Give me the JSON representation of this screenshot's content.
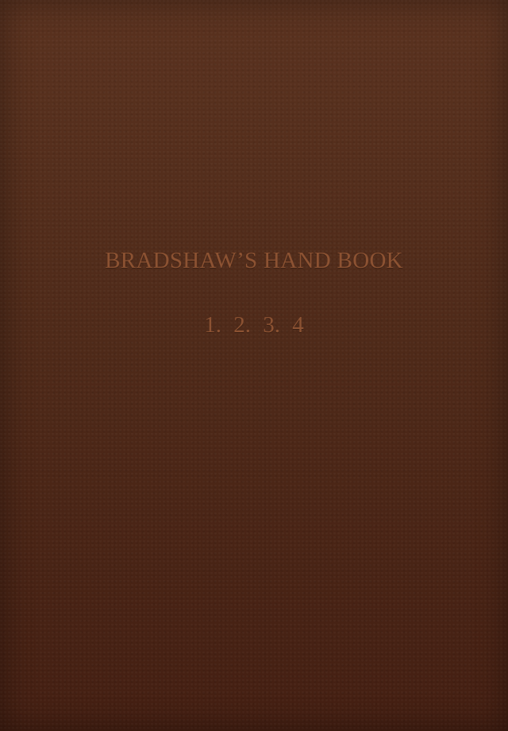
{
  "cover": {
    "title": "BRADSHAW’S HAND BOOK",
    "volumes": "1.  2.  3.  4",
    "colors": {
      "leather": "#4f2a19",
      "text": "#8c5232"
    }
  }
}
